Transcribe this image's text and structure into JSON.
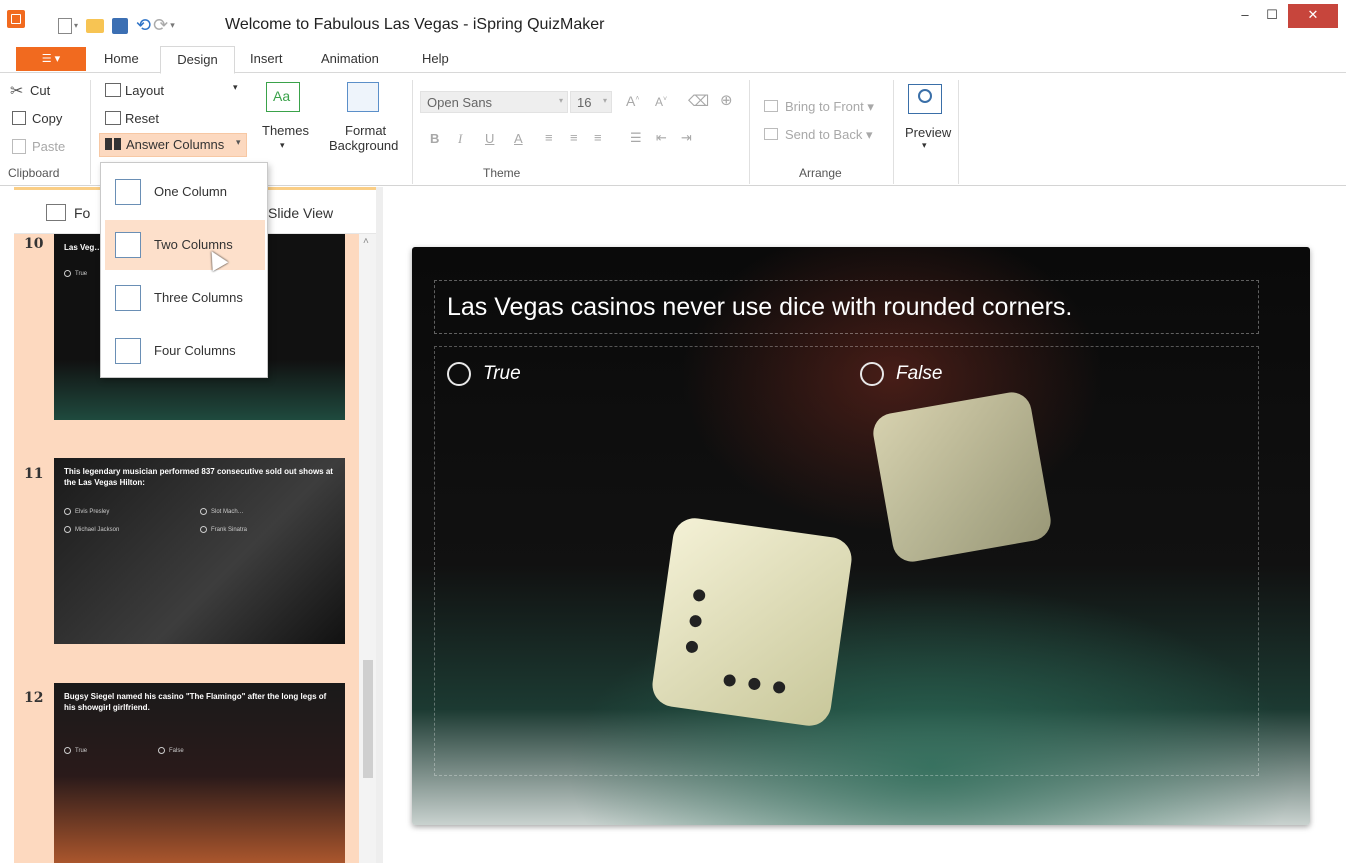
{
  "window": {
    "title": "Welcome to Fabulous Las Vegas - iSpring QuizMaker",
    "min": "–",
    "max": "☐",
    "close": "✕"
  },
  "qat": {
    "new_icon": "new-document-icon",
    "open_icon": "open-folder-icon",
    "save_icon": "save-icon",
    "undo_icon": "undo-icon",
    "redo_icon": "redo-icon",
    "more_icon": "customize-icon"
  },
  "tabs": {
    "file": "☰ ▾",
    "items": [
      "Home",
      "Design",
      "Insert",
      "Animation",
      "Help"
    ],
    "active": "Design"
  },
  "ribbon": {
    "clipboard": {
      "cut": "Cut",
      "copy": "Copy",
      "paste": "Paste",
      "label": "Clipboard"
    },
    "slide": {
      "layout": "Layout",
      "reset": "Reset",
      "answer_columns": "Answer Columns"
    },
    "themes": {
      "label": "Themes",
      "icon_text": "Aa"
    },
    "format_background": {
      "line1": "Format",
      "line2": "Background"
    },
    "theme": {
      "font": "Open Sans",
      "size": "16",
      "bold": "B",
      "italic": "I",
      "underline": "U",
      "font_color": "A",
      "label": "Theme"
    },
    "arrange": {
      "bring_to_front": "Bring to Front",
      "send_to_back": "Send to Back",
      "label": "Arrange"
    },
    "preview": {
      "label": "Preview"
    }
  },
  "left_panel": {
    "form_view_label": "Fo",
    "slide_view_label": "Slide View",
    "slides": [
      {
        "num": "10",
        "question": "Las Veg… d corners.",
        "options": [
          "True"
        ]
      },
      {
        "num": "11",
        "question": "This legendary musician performed 837 consecutive sold out shows at the Las Vegas Hilton:",
        "options": [
          "Elvis Presley",
          "Slot Mach…",
          "Michael Jackson",
          "Frank Sinatra"
        ]
      },
      {
        "num": "12",
        "question": "Bugsy Siegel named his casino \"The Flamingo\" after the long legs of his showgirl girlfriend.",
        "options": [
          "True",
          "False"
        ]
      }
    ]
  },
  "slide": {
    "question": "Las Vegas casinos never use dice with rounded corners.",
    "answers": [
      "True",
      "False"
    ]
  },
  "dropdown": {
    "items": [
      "One Column",
      "Two Columns",
      "Three Columns",
      "Four Columns"
    ],
    "highlighted": "Two Columns"
  },
  "colors": {
    "accent": "#f16a1f",
    "ribbon_selected": "#fcd9c0",
    "close_button": "#c7453c"
  }
}
